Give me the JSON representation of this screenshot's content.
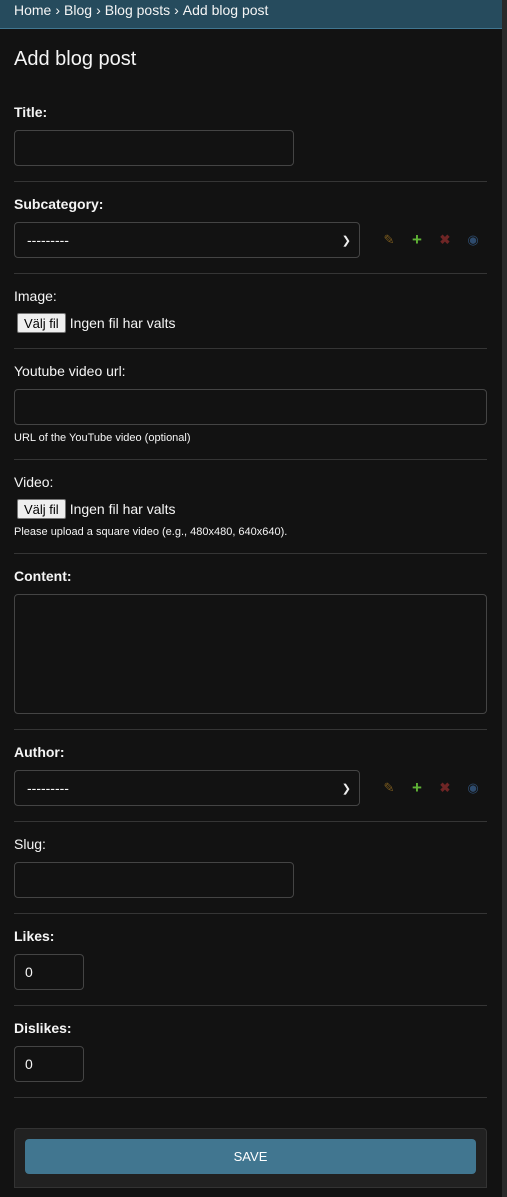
{
  "breadcrumbs": {
    "home": "Home",
    "app": "Blog",
    "model": "Blog posts",
    "current": "Add blog post",
    "separator": "›"
  },
  "page_title": "Add blog post",
  "fields": {
    "title": {
      "label": "Title:",
      "value": ""
    },
    "subcategory": {
      "label": "Subcategory:",
      "selected": "---------"
    },
    "image": {
      "label": "Image:",
      "button": "Välj fil",
      "status": "Ingen fil har valts"
    },
    "youtube": {
      "label": "Youtube video url:",
      "value": "",
      "help": "URL of the YouTube video (optional)"
    },
    "video": {
      "label": "Video:",
      "button": "Välj fil",
      "status": "Ingen fil har valts",
      "help": "Please upload a square video (e.g., 480x480, 640x640)."
    },
    "content": {
      "label": "Content:",
      "value": ""
    },
    "author": {
      "label": "Author:",
      "selected": "---------"
    },
    "slug": {
      "label": "Slug:",
      "value": ""
    },
    "likes": {
      "label": "Likes:",
      "value": "0"
    },
    "dislikes": {
      "label": "Dislikes:",
      "value": "0"
    }
  },
  "related_icons": [
    "pencil-icon",
    "plus-icon",
    "x-icon",
    "eye-icon"
  ],
  "submit": {
    "save_label": "SAVE"
  },
  "colors": {
    "header_bg": "#264b5d",
    "primary": "#417690",
    "body_bg": "#121212"
  }
}
